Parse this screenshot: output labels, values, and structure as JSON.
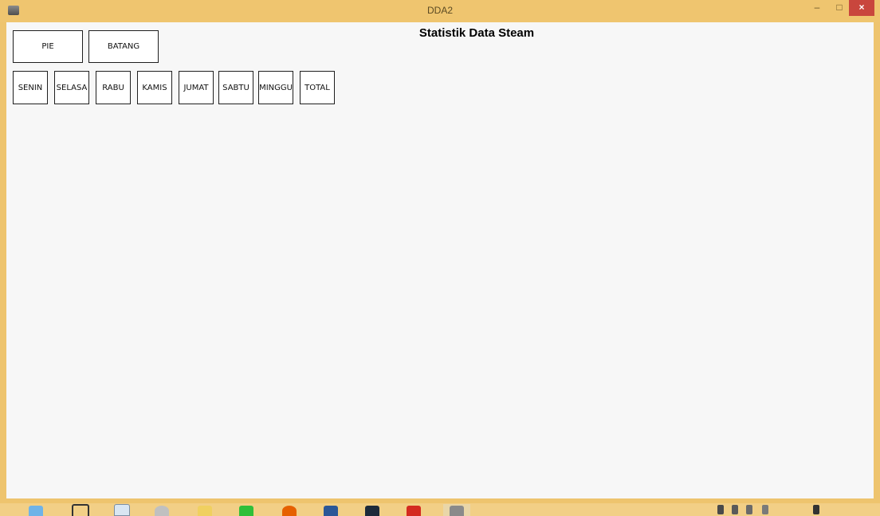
{
  "window": {
    "title": "DDA2",
    "controls": {
      "minimize": "–",
      "maximize": "□",
      "close": "×"
    }
  },
  "heading": "Statistik Data Steam",
  "chart_type_buttons": [
    {
      "label": "PIE"
    },
    {
      "label": "BATANG"
    }
  ],
  "day_buttons": [
    {
      "label": "SENIN"
    },
    {
      "label": "SELASA"
    },
    {
      "label": "RABU"
    },
    {
      "label": "KAMIS"
    },
    {
      "label": "JUMAT"
    },
    {
      "label": "SABTU"
    },
    {
      "label": "MINGGU"
    },
    {
      "label": "TOTAL"
    }
  ],
  "taskbar": {
    "icons": [
      "start-orb-icon",
      "unity-icon",
      "notepad-icon",
      "tool-icon",
      "folder-icon",
      "line-app-icon",
      "firefox-icon",
      "word-icon",
      "pdf-reader-icon",
      "acrobat-icon",
      "app-window-icon"
    ],
    "colors": {
      "line": "#2fbf3a",
      "word": "#2b5797",
      "acrobat": "#d42a20",
      "firefox": "#e66000"
    }
  }
}
